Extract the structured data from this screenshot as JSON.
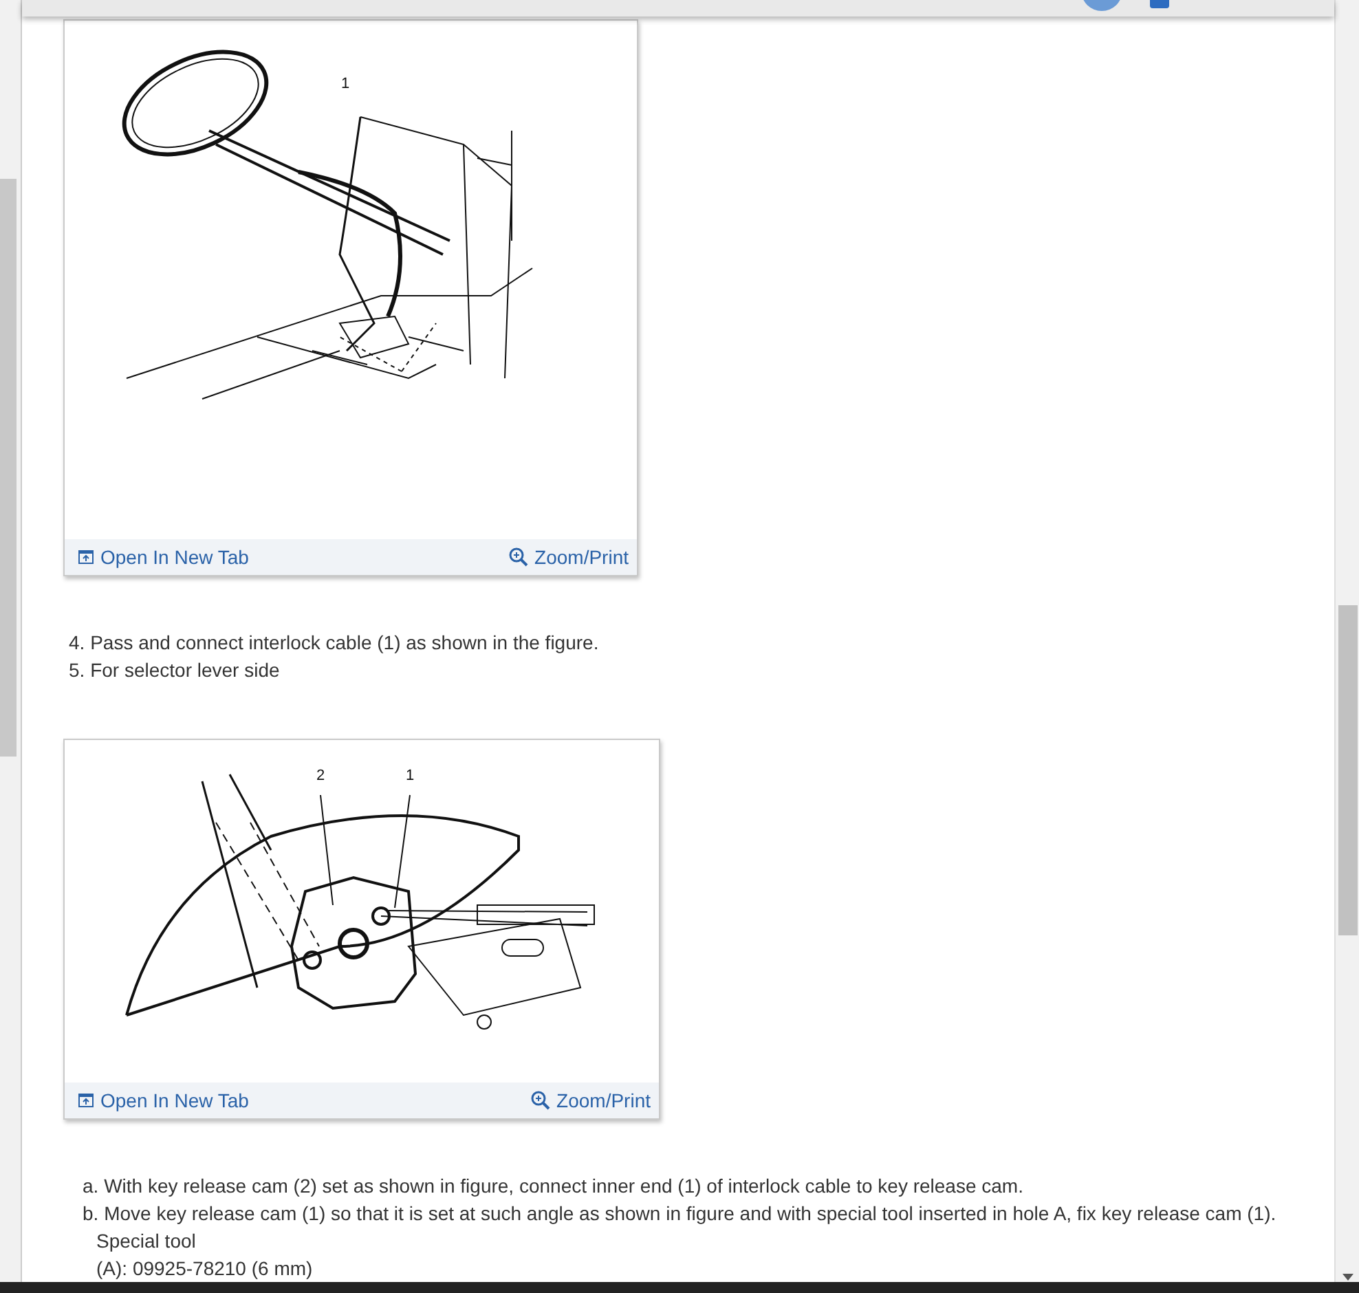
{
  "content": [
    {
      "kind": "figure",
      "callouts": [
        {
          "text": "1"
        }
      ],
      "open_link": "Open In New Tab",
      "zoom_link": "Zoom/Print"
    },
    {
      "kind": "steps",
      "items": [
        "4. Pass and connect interlock cable (1) as shown in the figure.",
        "5. For selector lever side"
      ]
    },
    {
      "kind": "figure",
      "callouts": [
        {
          "text": "2"
        },
        {
          "text": "1"
        }
      ],
      "open_link": "Open In New Tab",
      "zoom_link": "Zoom/Print"
    },
    {
      "kind": "substeps",
      "items": [
        "a. With key release cam (2) set as shown in figure, connect inner end (1) of interlock cable to key release cam.",
        "b. Move key release cam (1) so that it is set at such angle as shown in figure and with special tool inserted in hole A, fix key release cam (1)."
      ],
      "notes": [
        "Special tool",
        "(A): 09925-78210 (6 mm)"
      ]
    }
  ]
}
